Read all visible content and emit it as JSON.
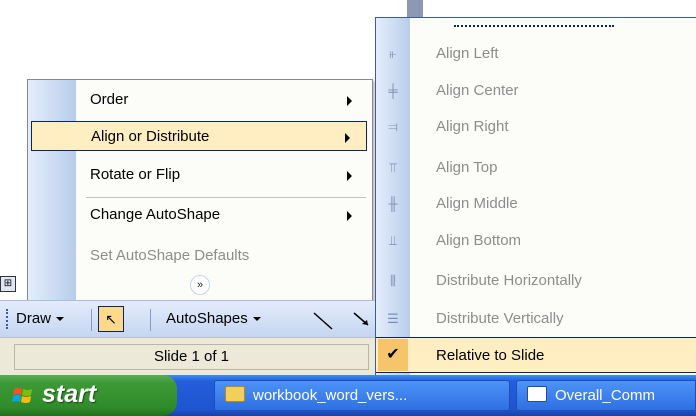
{
  "draw_menu": {
    "items": [
      {
        "label": "Order",
        "submenu": true,
        "state": "normal"
      },
      {
        "label": "Align or Distribute",
        "submenu": true,
        "state": "highlighted"
      },
      {
        "label": "Rotate or Flip",
        "submenu": true,
        "state": "normal"
      },
      {
        "label": "Change AutoShape",
        "submenu": true,
        "state": "normal"
      },
      {
        "label": "Set AutoShape Defaults",
        "submenu": false,
        "state": "disabled"
      }
    ],
    "expand_icon": "double-chevron-down-icon"
  },
  "align_submenu": {
    "items": [
      {
        "label": "Align Left",
        "icon": "align-left-icon",
        "state": "disabled"
      },
      {
        "label": "Align Center",
        "icon": "align-center-icon",
        "state": "disabled"
      },
      {
        "label": "Align Right",
        "icon": "align-right-icon",
        "state": "disabled"
      },
      {
        "label": "Align Top",
        "icon": "align-top-icon",
        "state": "disabled"
      },
      {
        "label": "Align Middle",
        "icon": "align-middle-icon",
        "state": "disabled"
      },
      {
        "label": "Align Bottom",
        "icon": "align-bottom-icon",
        "state": "disabled"
      },
      {
        "label": "Distribute Horizontally",
        "icon": "distribute-horizontal-icon",
        "state": "disabled"
      },
      {
        "label": "Distribute Vertically",
        "icon": "distribute-vertical-icon",
        "state": "disabled"
      },
      {
        "label": "Relative to Slide",
        "icon": "checkmark-icon",
        "state": "checked"
      }
    ]
  },
  "drawing_toolbar": {
    "draw_label": "Draw",
    "autoshapes_label": "AutoShapes"
  },
  "status_bar": {
    "slide_text": "Slide 1 of 1"
  },
  "taskbar": {
    "start_label": "start",
    "tasks": [
      {
        "label": "workbook_word_vers...",
        "icon": "folder-icon"
      },
      {
        "label": "Overall_Comm",
        "icon": "word-document-icon"
      }
    ]
  },
  "colors": {
    "menu_highlight": "#ffeec2",
    "menu_gutter": "#b8cdeb",
    "taskbar_blue": "#245edb",
    "start_green": "#3c9a35"
  }
}
